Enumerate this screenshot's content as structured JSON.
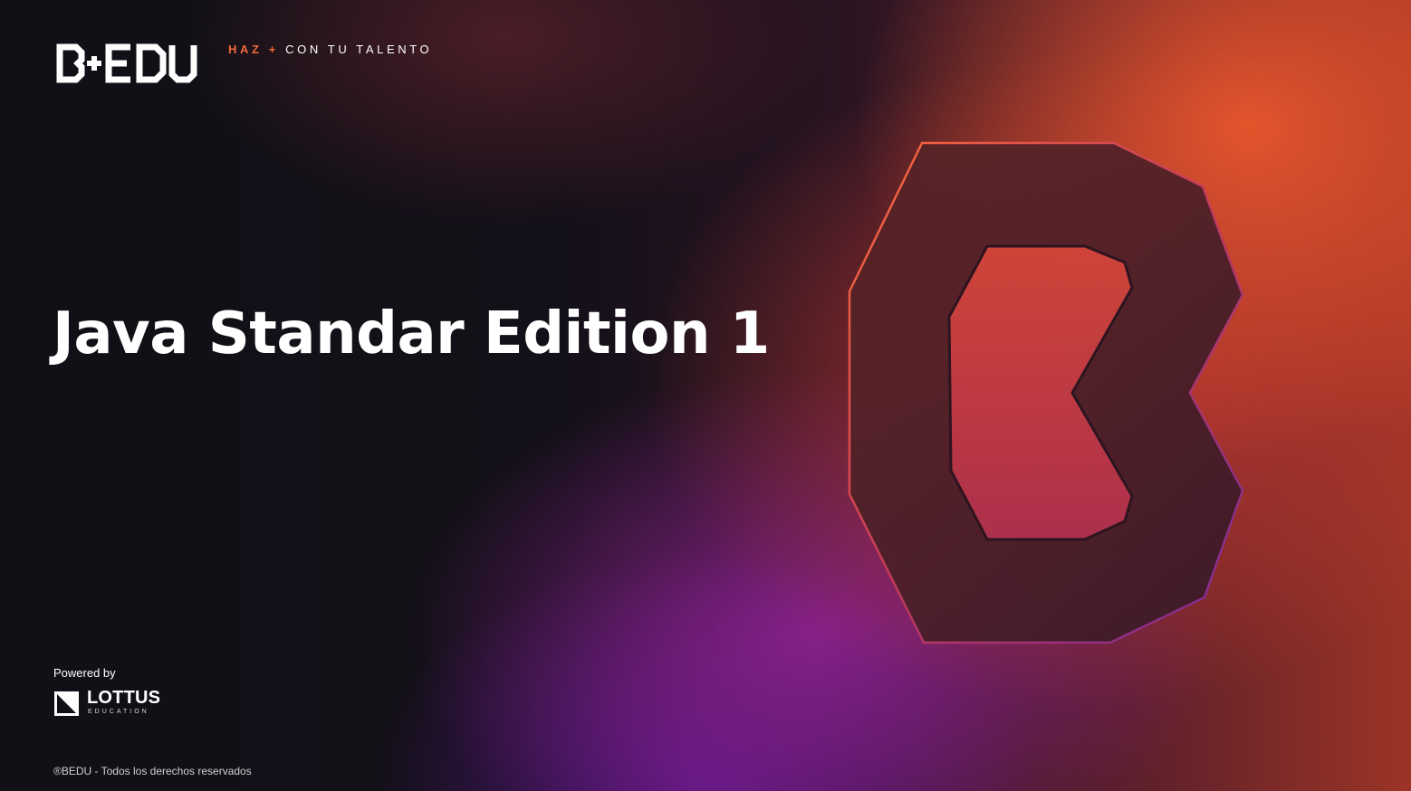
{
  "brand": {
    "logo_text": "B+EDU",
    "logo_icon": "bedu-logo",
    "tagline_highlight": "HAZ +",
    "tagline_rest": "CON TU TALENTO",
    "accent_color": "#f06a3b"
  },
  "slide": {
    "title": "Java Standar Edition 1",
    "hero_icon": "bedu-b-emblem"
  },
  "powered": {
    "label": "Powered by",
    "partner_name": "LOTTUS",
    "partner_sub": "EDUCATION",
    "partner_icon": "lottus-logo"
  },
  "footer": {
    "copyright": "®BEDU - Todos los derechos reservados"
  }
}
